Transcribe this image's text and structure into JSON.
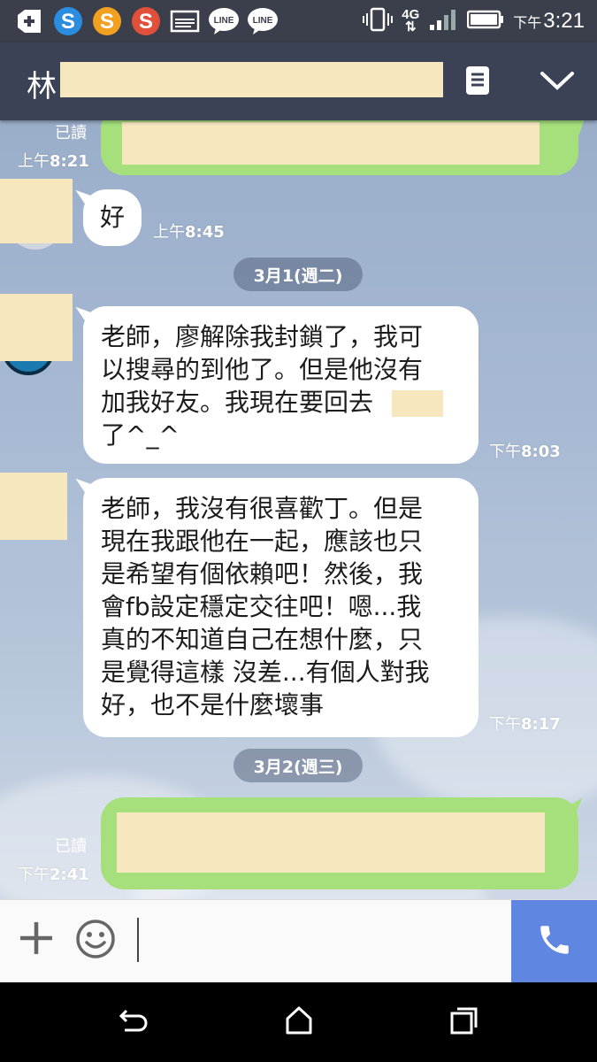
{
  "status_bar": {
    "time_prefix": "下午",
    "time": "3:21",
    "network": "4G",
    "icons": [
      "add-box-icon",
      "s-app-blue-icon",
      "s-app-orange-icon",
      "s-app-red-icon",
      "image-icon",
      "line-icon",
      "line-icon",
      "vibrate-icon",
      "network-4g-icon",
      "signal-icon",
      "battery-icon"
    ],
    "line_label": "LINE"
  },
  "header": {
    "title": "林",
    "menu_icon": "note-list-icon",
    "collapse_icon": "chevron-down-icon"
  },
  "messages": [
    {
      "direction": "out",
      "read": "已讀",
      "time_prefix": "上午",
      "time": "8:21",
      "text_redacted": true
    },
    {
      "direction": "in",
      "text": "好",
      "time_prefix": "上午",
      "time": "8:45"
    },
    {
      "type": "date",
      "label": "3月1(週二)"
    },
    {
      "direction": "in",
      "lines": [
        "老師，廖解除我封鎖了，我可",
        "以搜尋的到他了。但是他沒有",
        "加我好友。我現在要回去",
        "了^_^"
      ],
      "time_prefix": "下午",
      "time": "8:03"
    },
    {
      "direction": "in",
      "lines": [
        "老師，我沒有很喜歡丁。但是",
        "現在我跟他在一起，應該也只",
        "是希望有個依賴吧！然後，我",
        "會fb設定穩定交往吧！嗯...我",
        "真的不知道自己在想什麼，只",
        "是覺得這樣 沒差...有個人對我",
        "好，也不是什麼壞事"
      ],
      "time_prefix": "下午",
      "time": "8:17"
    },
    {
      "type": "date",
      "label": "3月2(週三)"
    },
    {
      "direction": "out",
      "read": "已讀",
      "time_prefix": "下午",
      "time": "2:41",
      "text_redacted": true
    }
  ],
  "input_bar": {
    "add_icon": "plus-icon",
    "emoji_icon": "emoji-icon",
    "call_icon": "phone-icon"
  },
  "nav_bar": {
    "back_icon": "back-icon",
    "home_icon": "home-icon",
    "recents_icon": "recents-icon"
  },
  "colors": {
    "header_bg": "#3b4256",
    "status_bg": "#3a3f4b",
    "bubble_in": "#ffffff",
    "bubble_out": "#a5e07c",
    "call_button": "#5f86e0",
    "redaction": "#f6e7bf"
  }
}
